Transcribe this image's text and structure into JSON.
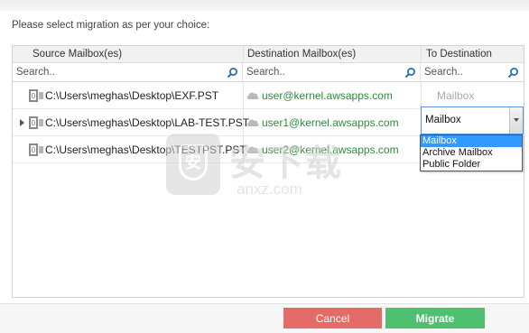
{
  "prompt": "Please select migration as per your choice:",
  "columns": {
    "source": "Source Mailbox(es)",
    "destination": "Destination Mailbox(es)",
    "to_destination": "To Destination"
  },
  "search": {
    "source_placeholder": "Search..",
    "destination_placeholder": "Search..",
    "to_destination_placeholder": "Search.."
  },
  "rows": [
    {
      "source": "C:\\Users\\meghas\\Desktop\\EXF.PST",
      "destination": "user@kernel.awsapps.com",
      "to_destination": "Mailbox"
    },
    {
      "source": "C:\\Users\\meghas\\Desktop\\LAB-TEST.PST",
      "destination": "user1@kernel.awsapps.com",
      "to_destination": "Mailbox"
    },
    {
      "source": "C:\\Users\\meghas\\Desktop\\TESTPST.PST",
      "destination": "user2@kernel.awsapps.com",
      "to_destination": ""
    }
  ],
  "dropdown_options": [
    "Mailbox",
    "Archive Mailbox",
    "Public Folder"
  ],
  "watermark": {
    "cn": "安下载",
    "en": "anxz.com",
    "logo": "安"
  },
  "buttons": {
    "cancel": "Cancel",
    "migrate": "Migrate"
  },
  "colors": {
    "email": "#2e8b3c",
    "cancel": "#e46c68",
    "migrate": "#4fbf72",
    "selection": "#3399ff"
  },
  "icons": {
    "row_file": "pst-file-icon",
    "row_cloud": "cloud-icon",
    "search": "search-icon"
  }
}
